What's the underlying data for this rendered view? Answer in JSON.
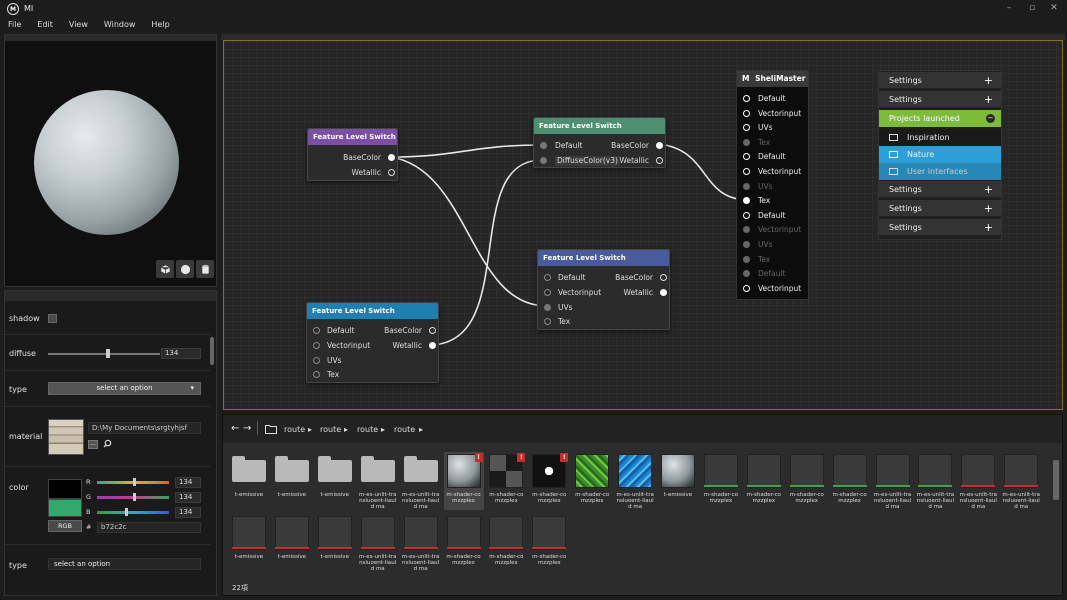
{
  "app": {
    "title": "MI",
    "logo_letter": "M"
  },
  "menu": [
    "File",
    "Edit",
    "View",
    "Window",
    "Help"
  ],
  "window_controls": [
    "minimize",
    "maximize",
    "close"
  ],
  "properties": {
    "shadow_label": "shadow",
    "diffuse_label": "diffuse",
    "diffuse_value": "134",
    "diffuse_level": 0.52,
    "type_label": "type",
    "type_select": "select an option",
    "material_label": "material",
    "material_path": "D:\\My Documents\\srgtyhjsf",
    "material_browse": "...",
    "color_label": "color",
    "color_r_label": "R",
    "color_g_label": "G",
    "color_b_label": "B",
    "color_r": "134",
    "color_g": "134",
    "color_b": "134",
    "rgb_button": "RGB",
    "hex_prefix": "#",
    "hex_value": "b72c2c",
    "swatch_color": "#33a96e",
    "type2_label": "type",
    "type2_select": "select an option"
  },
  "nodes": {
    "n1": {
      "title": "Feature Level Switch",
      "color": "#7a4fa5",
      "outputs": [
        "BaseColor",
        "Wetallic"
      ]
    },
    "n2": {
      "title": "Feature Level Switch",
      "color": "#4e8f73",
      "inputs": [
        "Default",
        "DiffuseColor(v3)"
      ],
      "outputs": [
        "BaseColor",
        "Wetallic"
      ]
    },
    "n3": {
      "title": "Feature Level Switch",
      "color": "#4a5b9c",
      "inputs": [
        "Default",
        "Vectorinput",
        "UVs",
        "Tex"
      ],
      "outputs": [
        "BaseColor",
        "Wetallic"
      ]
    },
    "n4": {
      "title": "Feature Level Switch",
      "color": "#1f7fb0",
      "inputs": [
        "Default",
        "Vectorinput",
        "UVs",
        "Tex"
      ],
      "outputs": [
        "BaseColor",
        "Wetallic"
      ]
    },
    "master": {
      "title": "SheliMaster",
      "icon_letter": "M",
      "ports": [
        "Default",
        "Vectorinput",
        "UVs",
        "Tex",
        "Default",
        "Vectorinput",
        "UVs",
        "Tex",
        "Default",
        "Vectorinput",
        "UVs",
        "Tex",
        "Default",
        "Vectorinput"
      ]
    }
  },
  "right_panel": {
    "items": [
      "Settings",
      "Settings",
      "Projects launched",
      "Inspiration",
      "Nature",
      "User interfaces",
      "Settings",
      "Settings",
      "Settings"
    ],
    "accent": "#7dbb3a",
    "selection": "#2e9fd6"
  },
  "browser": {
    "crumbs": [
      "route",
      "route",
      "route",
      "route"
    ],
    "count": "22項",
    "row1": [
      "t-emissive",
      "t-emissive",
      "t-emissive",
      "m-es-unlit-tra nsluoent-liaul d ma",
      "m-es-unlit-tra nsluoent-liaul d ma",
      "m-shader-co mzzplex",
      "m-shader-co mzzplex",
      "m-shader-co mzzplex",
      "m-shader-co mzzplex",
      "m-es-unlit-tra nsluoent-liaul d ma",
      "t-emissive",
      "m-shader-co mzzplex",
      "m-shader-co mzzplex",
      "m-shader-co mzzplex",
      "m-shader-co mzzplex",
      "m-es-unlit-tra nsluoent-liaul d ma",
      "m-es-unlit-tra nsluoent-liaul d ma",
      "m-es-unlit-tra nsluoent-liaul d ma",
      "m-es-unlit-tra nsluoent-liaul d ma"
    ],
    "row2": [
      "t-emissive",
      "t-emissive",
      "t-emissive",
      "m-es-unlit-tra nsluoent-liaul d ma",
      "m-es-unlit-tra nsluoent-liaul d ma",
      "m-shader-co mzzplex",
      "m-shader-co mzzplex",
      "m-shader-co mzzplex"
    ]
  }
}
